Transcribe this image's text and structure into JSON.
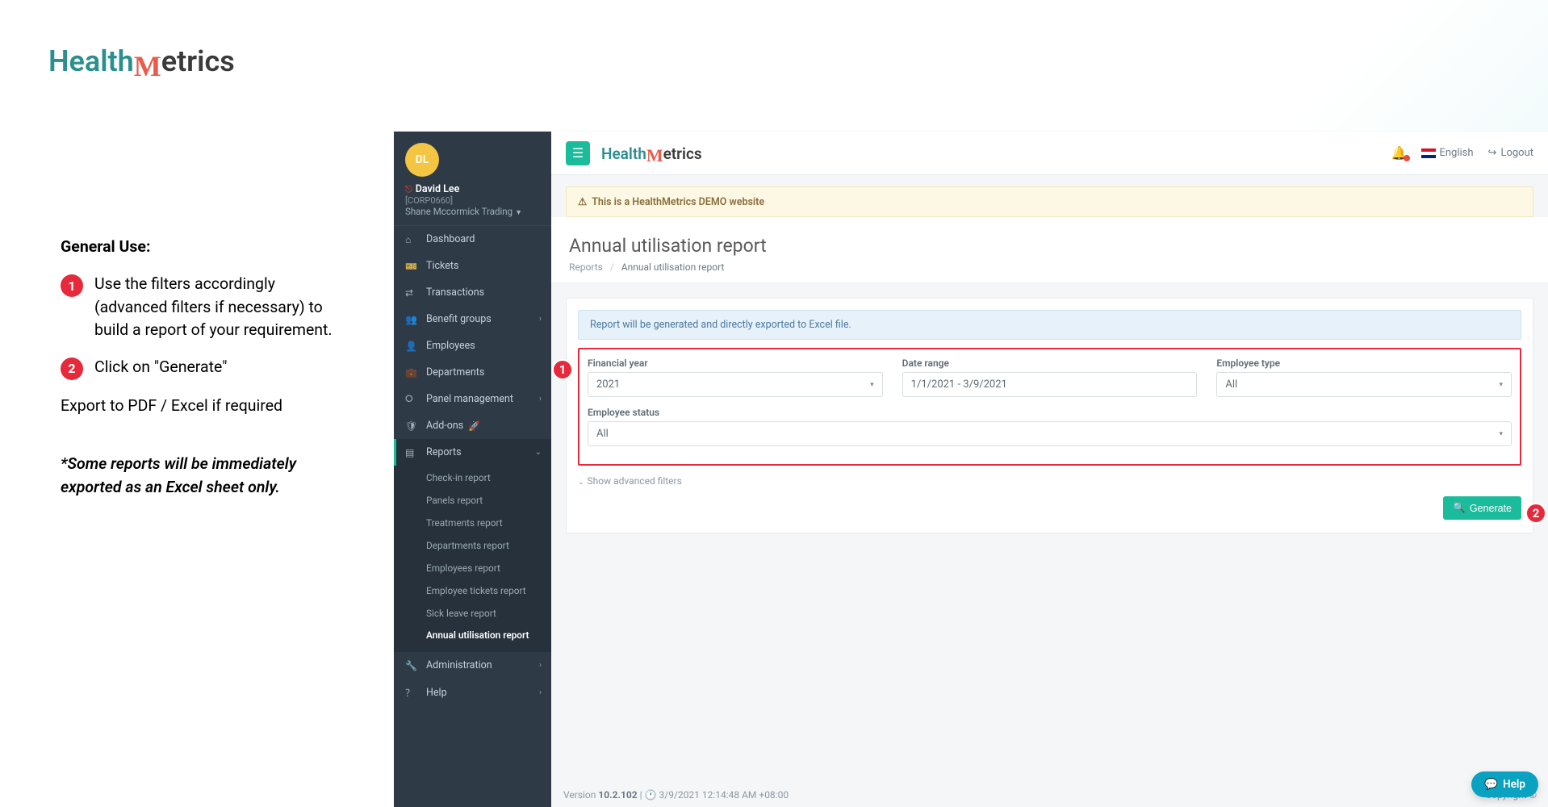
{
  "outer_logo": {
    "part1": "Health",
    "part2": "M",
    "part3": "etrics"
  },
  "instructions": {
    "heading": "General Use:",
    "step1": "Use the filters accordingly (advanced filters if necessary) to build a report of your requirement.",
    "step2": "Click on \"Generate\"",
    "export": "Export to PDF / Excel if required",
    "note": "*Some reports will be immediately exported as an Excel sheet only."
  },
  "profile": {
    "initials": "DL",
    "name": "David Lee",
    "org": "[CORP0660]",
    "company": "Shane Mccormick Trading"
  },
  "nav": {
    "dashboard": "Dashboard",
    "tickets": "Tickets",
    "transactions": "Transactions",
    "benefit_groups": "Benefit groups",
    "employees": "Employees",
    "departments": "Departments",
    "panel_management": "Panel management",
    "addons": "Add-ons",
    "reports": "Reports",
    "administration": "Administration",
    "help": "Help"
  },
  "reports_sub": {
    "checkin": "Check-in report",
    "panels": "Panels report",
    "treatments": "Treatments report",
    "departments": "Departments report",
    "employees": "Employees report",
    "employee_tickets": "Employee tickets report",
    "sick_leave": "Sick leave report",
    "annual_utilisation": "Annual utilisation report"
  },
  "topbar": {
    "language": "English",
    "logout": "Logout"
  },
  "demo_banner": "This is a HealthMetrics DEMO website",
  "page": {
    "title": "Annual utilisation report",
    "breadcrumb_root": "Reports",
    "breadcrumb_current": "Annual utilisation report"
  },
  "info_bar": "Report will be generated and directly exported to Excel file.",
  "filters": {
    "financial_year": {
      "label": "Financial year",
      "value": "2021"
    },
    "date_range": {
      "label": "Date range",
      "value": "1/1/2021 - 3/9/2021"
    },
    "employee_type": {
      "label": "Employee type",
      "value": "All"
    },
    "employee_status": {
      "label": "Employee status",
      "value": "All"
    }
  },
  "advanced_filters": "Show advanced filters",
  "generate_button": "Generate",
  "footer": {
    "version_label": "Version",
    "version": "10.2.102",
    "timestamp": "3/9/2021 12:14:48 AM +08:00",
    "copyright": "Copyright ©"
  },
  "help_bubble": "Help"
}
